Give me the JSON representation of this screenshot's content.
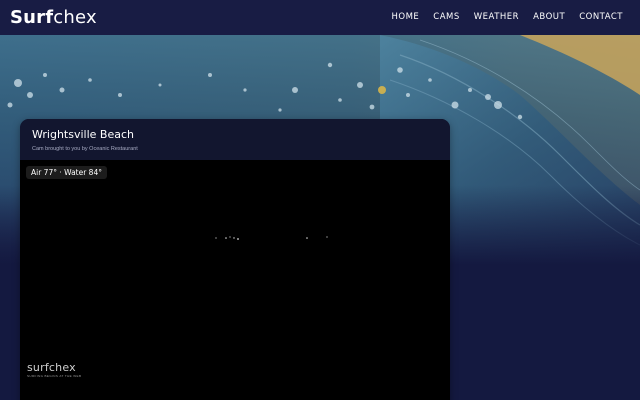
{
  "header": {
    "logo_bold": "Surf",
    "logo_light": "chex",
    "nav": [
      {
        "label": "HOME"
      },
      {
        "label": "CAMS"
      },
      {
        "label": "WEATHER"
      },
      {
        "label": "ABOUT"
      },
      {
        "label": "CONTACT"
      }
    ]
  },
  "cam": {
    "title": "Wrightsville Beach",
    "sponsor": "Cam brought to you by Oceanic Restaurant",
    "conditions": "Air 77° · Water 84°",
    "watermark_logo": "surfchex",
    "watermark_tagline": "SURFING BEGINS AT THE WEB"
  },
  "colors": {
    "nav_background": "#181c44",
    "page_background": "#141940",
    "card_background": "#10142f",
    "wave_blue": "#2d5a78",
    "sky_gold": "#c9a55a"
  }
}
